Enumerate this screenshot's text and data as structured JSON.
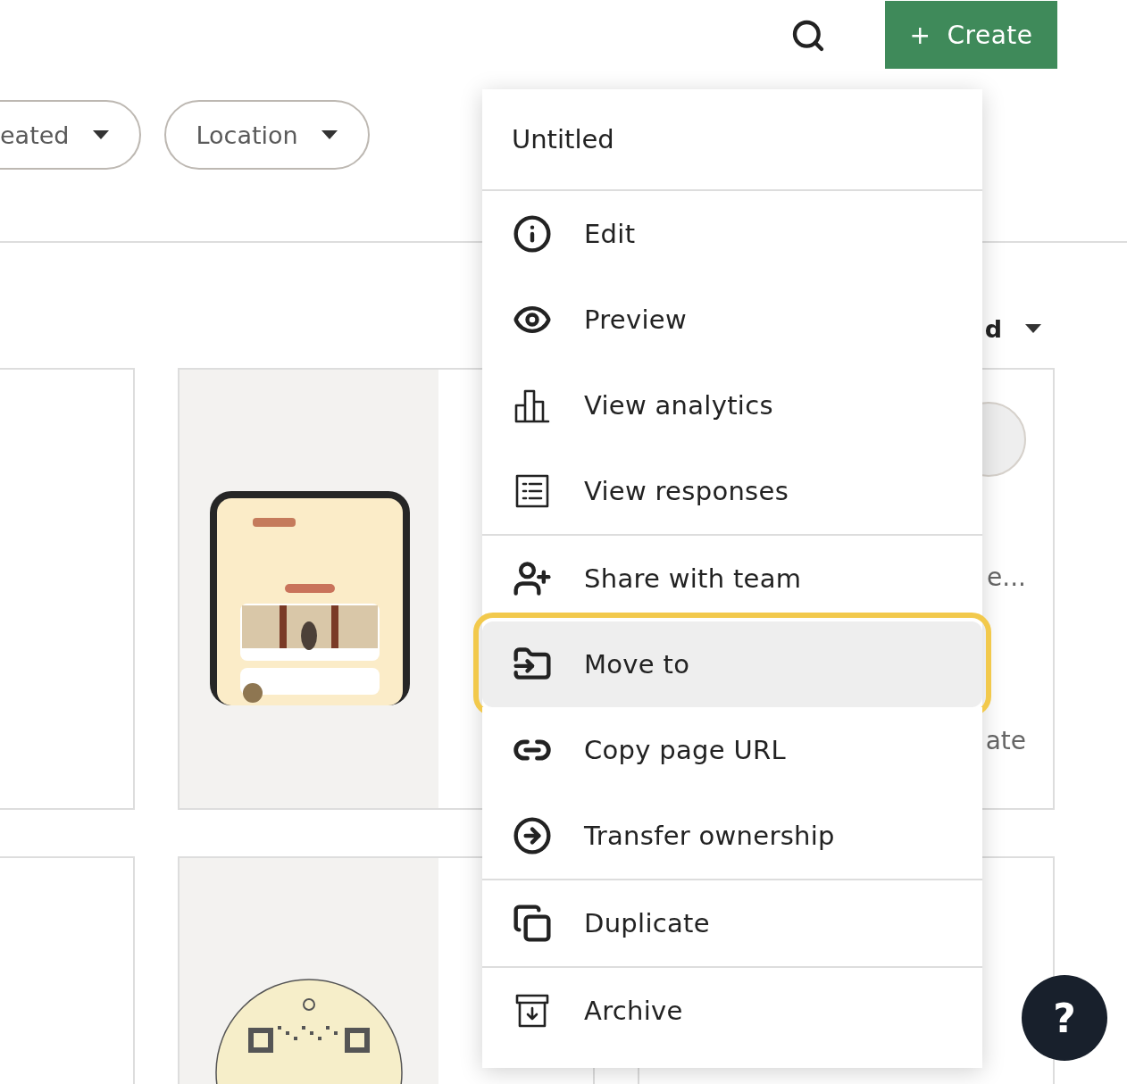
{
  "top_bar": {
    "create_button": {
      "icon": "+",
      "label": "Create"
    }
  },
  "filters": [
    {
      "label": "eated"
    },
    {
      "label": "Location"
    }
  ],
  "sort": {
    "label": "d"
  },
  "card_rows": [
    [
      {
        "kind": "blank"
      },
      {
        "kind": "picture"
      },
      {
        "kind": "details",
        "texts": [
          "e...",
          "ate"
        ]
      }
    ],
    [
      {
        "kind": "blank"
      },
      {
        "kind": "picture"
      },
      {
        "kind": "blank"
      }
    ]
  ],
  "menu": {
    "title": "Untitled",
    "groups": [
      [
        {
          "label": "Edit",
          "selected": false
        },
        {
          "label": "Preview",
          "selected": false
        },
        {
          "label": "View analytics",
          "selected": false
        },
        {
          "label": "View responses",
          "selected": false
        }
      ],
      [
        {
          "label": "Share with team",
          "selected": false
        },
        {
          "label": "Move to",
          "selected": true
        },
        {
          "label": "Copy page URL",
          "selected": false
        },
        {
          "label": "Transfer ownership",
          "selected": false
        }
      ],
      [
        {
          "label": "Duplicate",
          "selected": false
        }
      ],
      [
        {
          "label": "Archive",
          "selected": false
        }
      ]
    ]
  },
  "help_button": {
    "label": "?"
  }
}
